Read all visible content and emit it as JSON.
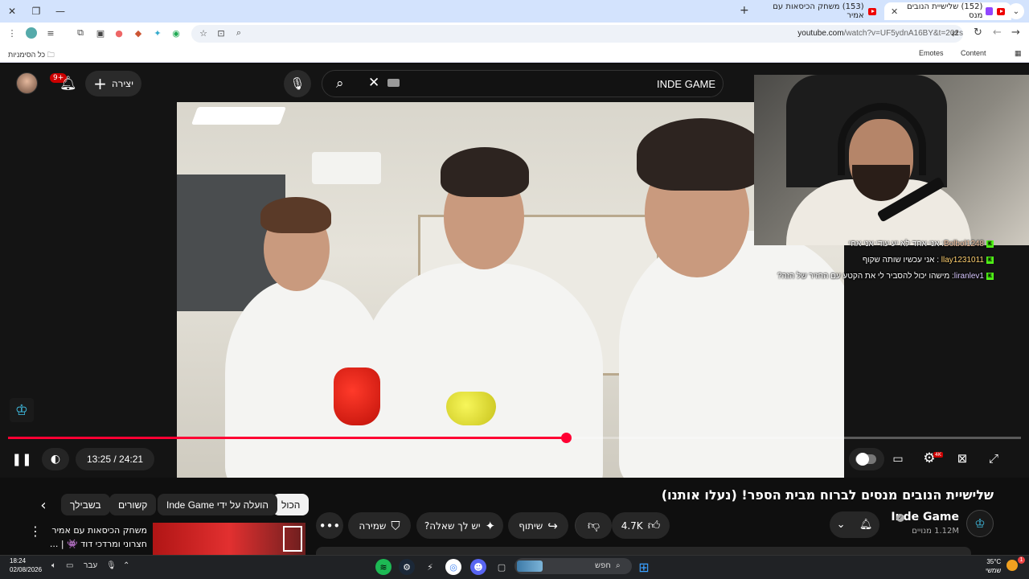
{
  "browser": {
    "tabs": [
      {
        "title": "(152) שלישיית הנובים מנס",
        "active": true
      },
      {
        "title": "(153) משחק הכיסאות עם אמיר",
        "active": false
      }
    ],
    "url_host": "youtube.com",
    "url_path": "/watch?v=UF5ydnA16BY&t=202s",
    "bookmarks": {
      "all_bookmarks": "כל הסימניות",
      "emotes": "Emotes",
      "content": "Content"
    }
  },
  "youtube": {
    "notifications_badge": "9+",
    "create_label": "יצירה",
    "search_value": "INDE GAME",
    "video": {
      "title": "שלישיית הנובים מנסים לברוח מבית הספר! (נעלו אותנו)",
      "time": "13:25 / 24:21",
      "progress": 0.551,
      "quality_badge": "4K"
    },
    "chat_overlay": [
      {
        "user": "Bolbol1248",
        "message": "אני אחד לא יע עודי אני אחי"
      },
      {
        "user": "llay1231011",
        "message": "אני עכשיו שותה שקוף"
      },
      {
        "user": "liranlev1",
        "message": "מישהו יכול להסביר לי את הקטע עם החזיר של הזה?"
      }
    ],
    "chips": {
      "all": "הכול",
      "uploaded_by": "הועלה על ידי Inde Game",
      "related": "קשורים",
      "for_you": "בשבילך"
    },
    "channel": {
      "name": "Inde Game",
      "subscribers": "1.12M מנויים"
    },
    "actions": {
      "likes": "4.7K",
      "share": "שיתוף",
      "ask": "יש לך שאלה?",
      "save": "שמירה"
    },
    "related": {
      "title": "משחק הכיסאות עם אמיר חצרוני ומרדכי דוד 👾 | ..."
    }
  },
  "taskbar": {
    "time": "18:24",
    "date": "02/08/2026",
    "language": "עבר",
    "search_label": "חפש",
    "temperature": "35°C",
    "weather_desc": "שמשי",
    "weather_badge": "1"
  },
  "icons": [
    "search-icon",
    "mic-icon",
    "bell-icon",
    "plus-icon",
    "pause-icon",
    "volume-icon",
    "settings-icon",
    "subtitles-icon",
    "fullscreen-icon",
    "like-icon",
    "dislike-icon",
    "share-icon",
    "save-icon",
    "sparkle-icon"
  ]
}
